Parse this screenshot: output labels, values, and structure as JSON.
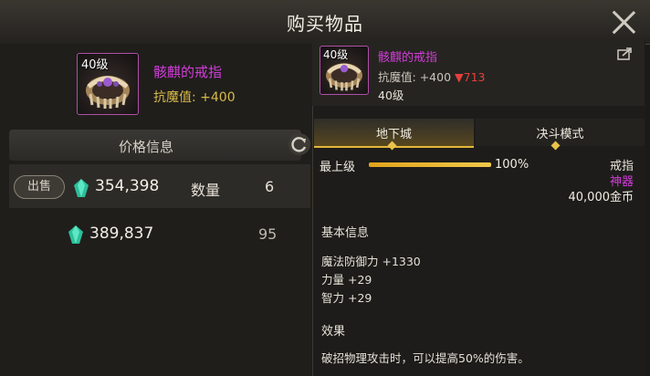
{
  "header": {
    "title": "购买物品"
  },
  "item": {
    "level": "40级",
    "name": "骸麒的戒指",
    "resist_label": "抗魔值:",
    "resist_value": "+400"
  },
  "price": {
    "header": "价格信息",
    "sell_label": "出售",
    "rows": [
      {
        "price": "354,398",
        "qty_label": "数量",
        "qty": "6"
      },
      {
        "price": "389,837",
        "qty": "95"
      }
    ]
  },
  "tooltip": {
    "level_badge": "40级",
    "name": "骸麒的戒指",
    "resist_label": "抗魔值:",
    "resist_value": "+400",
    "resist_diff": "▼713",
    "level": "40级",
    "tabs": [
      "地下城",
      "决斗模式"
    ],
    "max_label": "最上级",
    "progress": 1.0,
    "progress_text": "100%",
    "type": "戒指",
    "rarity": "神器",
    "gold": "40,000金币",
    "basic_info_title": "基本信息",
    "stats": [
      "魔法防御力 +1330",
      "力量 +29",
      "智力 +29"
    ],
    "effect_title": "效果",
    "effect_text": "破招物理攻击时，可以提高50%的伤害。"
  },
  "colors": {
    "epic_name": "#d23dd8",
    "resist_yellow": "#d8b94a",
    "accent_gold": "#e4b73a",
    "down_red": "#e6403b"
  }
}
